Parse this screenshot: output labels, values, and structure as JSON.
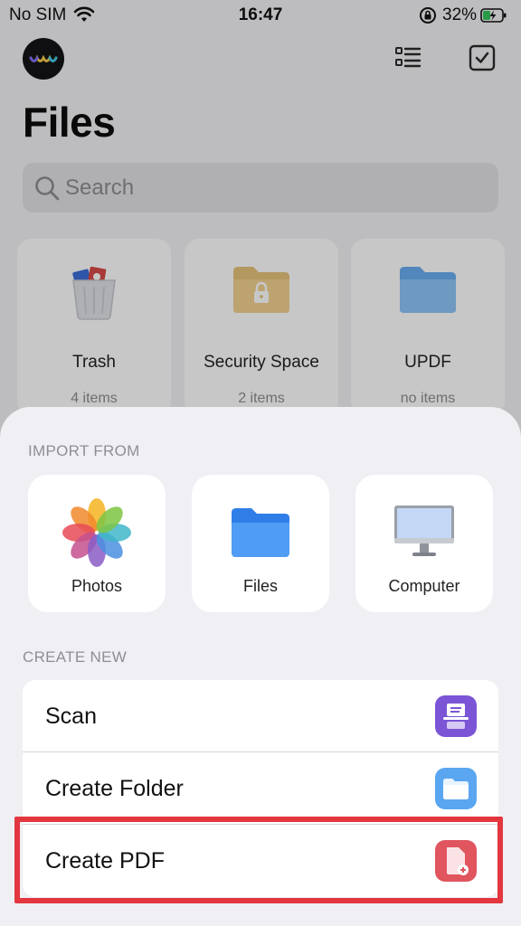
{
  "status_bar": {
    "carrier": "No SIM",
    "time": "16:47",
    "battery_pct": "32%"
  },
  "header": {
    "title": "Files"
  },
  "search": {
    "placeholder": "Search"
  },
  "cards": [
    {
      "name": "Trash",
      "count": "4 items",
      "icon": "trash-icon"
    },
    {
      "name": "Security Space",
      "count": "2 items",
      "icon": "locked-folder-icon"
    },
    {
      "name": "UPDF",
      "count": "no items",
      "icon": "folder-icon"
    }
  ],
  "sheet": {
    "import_label": "IMPORT FROM",
    "import_items": [
      {
        "label": "Photos",
        "icon": "photos-icon"
      },
      {
        "label": "Files",
        "icon": "files-folder-icon"
      },
      {
        "label": "Computer",
        "icon": "computer-icon"
      }
    ],
    "create_label": "CREATE NEW",
    "create_items": [
      {
        "label": "Scan",
        "icon": "scan-icon",
        "color": "#7b55d6"
      },
      {
        "label": "Create Folder",
        "icon": "folder-icon",
        "color": "#5aa6f0"
      },
      {
        "label": "Create PDF",
        "icon": "pdf-add-icon",
        "color": "#e0555e"
      }
    ],
    "highlighted_item": "Create PDF",
    "highlight_color": "#e3363f"
  }
}
